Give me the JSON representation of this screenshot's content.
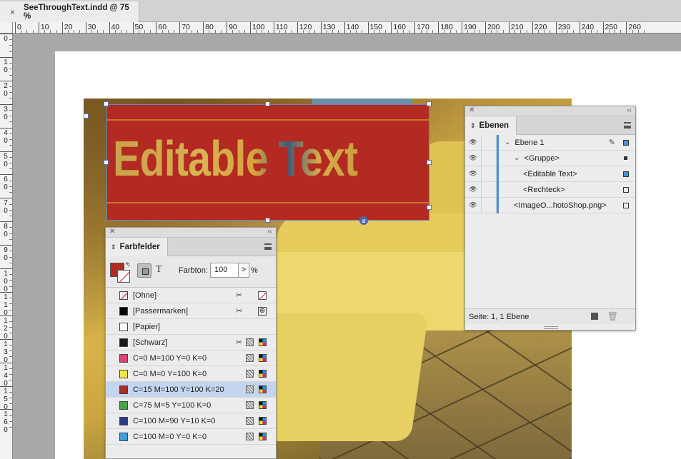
{
  "document": {
    "tab_title": "SeeThroughText.indd @ 75 %",
    "close_glyph": "×"
  },
  "ruler": {
    "h_labels": [
      "0",
      "10",
      "20",
      "30",
      "40",
      "50",
      "60",
      "70",
      "80",
      "90",
      "100",
      "110",
      "120",
      "130",
      "140",
      "150",
      "160",
      "170",
      "180",
      "190",
      "200",
      "210",
      "220",
      "230",
      "240",
      "250",
      "260"
    ],
    "v_labels": [
      "0",
      "1\n0",
      "2\n0",
      "3\n0",
      "4\n0",
      "5\n0",
      "6\n0",
      "7\n0",
      "8\n0",
      "9\n0",
      "1\n0\n0",
      "1\n1\n0",
      "1\n2\n0",
      "1\n3\n0",
      "1\n4\n0",
      "1\n5\n0",
      "1\n6\n0"
    ]
  },
  "canvas": {
    "editable_text": "Editable Text",
    "text_color": "#b22a22"
  },
  "layers_panel": {
    "tab_label": "Ebenen",
    "rows": [
      {
        "name": "Ebene 1",
        "level": 0,
        "expanded": true,
        "locked_pen": true,
        "square_filled": true
      },
      {
        "name": "<Gruppe>",
        "level": 1,
        "expanded": true,
        "square_filled": false
      },
      {
        "name": "<Editable Text>",
        "level": 2,
        "square_filled": true
      },
      {
        "name": "<Rechteck>",
        "level": 2,
        "square_filled": false
      },
      {
        "name": "<ImageO...hotoShop.png>",
        "level": 1,
        "square_filled": false
      }
    ],
    "footer": "Seite: 1, 1 Ebene",
    "accent": "#4a8de0"
  },
  "swatches_panel": {
    "tab_label": "Farbfelder",
    "tint_label": "Farbton:",
    "tint_value": "100",
    "tint_arrow": ">",
    "percent": "%",
    "text_glyph": "T",
    "swatches": [
      {
        "name": "[Ohne]",
        "color": "none",
        "kind": "none"
      },
      {
        "name": "[Passermarken]",
        "color": "#000000",
        "kind": "registration"
      },
      {
        "name": "[Papier]",
        "color": "#ffffff",
        "kind": "paper"
      },
      {
        "name": "[Schwarz]",
        "color": "#1a1a1a",
        "kind": "black"
      },
      {
        "name": "C=0 M=100 Y=0 K=0",
        "color": "#e0407a",
        "kind": "process"
      },
      {
        "name": "C=0 M=0 Y=100 K=0",
        "color": "#f5e642",
        "kind": "process"
      },
      {
        "name": "C=15 M=100 Y=100 K=20",
        "color": "#b22a22",
        "kind": "process",
        "selected": true
      },
      {
        "name": "C=75 M=5 Y=100 K=0",
        "color": "#3fa845",
        "kind": "process"
      },
      {
        "name": "C=100 M=90 Y=10 K=0",
        "color": "#2a3a8a",
        "kind": "process"
      },
      {
        "name": "C=100 M=0 Y=0 K=0",
        "color": "#3aa0e0",
        "kind": "process"
      }
    ]
  }
}
